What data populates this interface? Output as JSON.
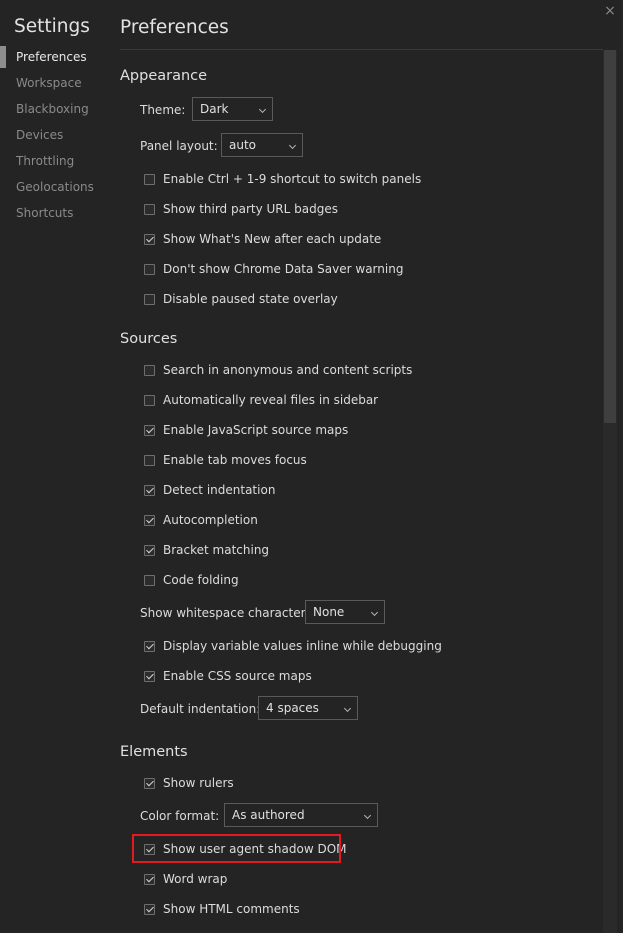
{
  "sidebar": {
    "title": "Settings",
    "items": [
      {
        "label": "Preferences"
      },
      {
        "label": "Workspace"
      },
      {
        "label": "Blackboxing"
      },
      {
        "label": "Devices"
      },
      {
        "label": "Throttling"
      },
      {
        "label": "Geolocations"
      },
      {
        "label": "Shortcuts"
      }
    ],
    "active": "Preferences"
  },
  "close_glyph": "×",
  "main": {
    "title": "Preferences",
    "appearance": {
      "title": "Appearance",
      "theme": {
        "label": "Theme:",
        "value": "Dark"
      },
      "panel_layout": {
        "label": "Panel layout:",
        "value": "auto"
      },
      "checkboxes": [
        {
          "label": "Enable Ctrl + 1-9 shortcut to switch panels",
          "checked": false
        },
        {
          "label": "Show third party URL badges",
          "checked": false
        },
        {
          "label": "Show What's New after each update",
          "checked": true
        },
        {
          "label": "Don't show Chrome Data Saver warning",
          "checked": false
        },
        {
          "label": "Disable paused state overlay",
          "checked": false
        }
      ]
    },
    "sources": {
      "title": "Sources",
      "checkboxes": [
        {
          "label": "Search in anonymous and content scripts",
          "checked": false
        },
        {
          "label": "Automatically reveal files in sidebar",
          "checked": false
        },
        {
          "label": "Enable JavaScript source maps",
          "checked": true
        },
        {
          "label": "Enable tab moves focus",
          "checked": false
        },
        {
          "label": "Detect indentation",
          "checked": true
        },
        {
          "label": "Autocompletion",
          "checked": true
        },
        {
          "label": "Bracket matching",
          "checked": true
        },
        {
          "label": "Code folding",
          "checked": false
        }
      ],
      "whitespace": {
        "label": "Show whitespace characters:",
        "value": "None"
      },
      "checkboxes2": [
        {
          "label": "Display variable values inline while debugging",
          "checked": true
        },
        {
          "label": "Enable CSS source maps",
          "checked": true
        }
      ],
      "indentation": {
        "label": "Default indentation:",
        "value": "4 spaces"
      }
    },
    "elements": {
      "title": "Elements",
      "show_rulers": {
        "label": "Show rulers",
        "checked": true
      },
      "color_format": {
        "label": "Color format:",
        "value": "As authored"
      },
      "checkboxes": [
        {
          "label": "Show user agent shadow DOM",
          "checked": true
        },
        {
          "label": "Word wrap",
          "checked": true
        },
        {
          "label": "Show HTML comments",
          "checked": true
        }
      ]
    }
  },
  "colors": {
    "highlight": "#e21b21",
    "background": "#242424"
  }
}
